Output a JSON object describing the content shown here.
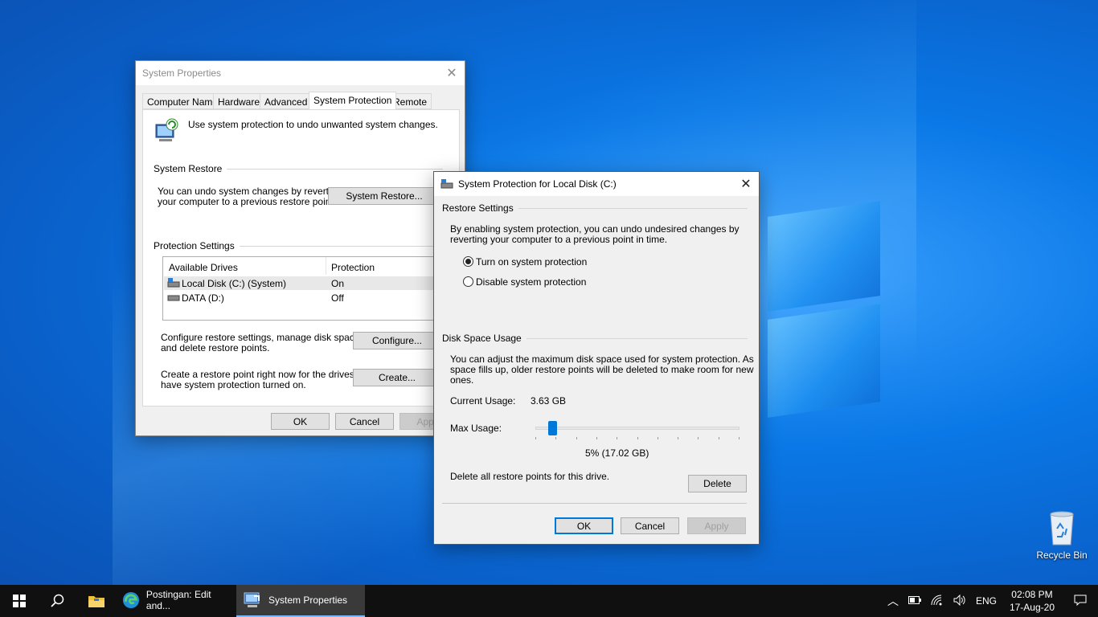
{
  "colors": {
    "accent": "#0078d7",
    "desktop": "#0a78e6",
    "taskbar": "#101010"
  },
  "desktop": {
    "recycle_bin_label": "Recycle Bin"
  },
  "system_properties": {
    "title": "System Properties",
    "tabs": [
      "Computer Name",
      "Hardware",
      "Advanced",
      "System Protection",
      "Remote"
    ],
    "active_tab": "System Protection",
    "intro_text": "Use system protection to undo unwanted system changes.",
    "system_restore_group": "System Restore",
    "system_restore_desc_1": "You can undo system changes by reverting",
    "system_restore_desc_2": "your computer to a previous restore point.",
    "system_restore_button": "System Restore...",
    "protection_group": "Protection Settings",
    "drives_columns": [
      "Available Drives",
      "Protection"
    ],
    "drives": [
      {
        "name": "Local Disk (C:) (System)",
        "protection": "On",
        "icon": "system-drive-icon"
      },
      {
        "name": "DATA (D:)",
        "protection": "Off",
        "icon": "drive-icon"
      }
    ],
    "configure_desc_1": "Configure restore settings, manage disk space,",
    "configure_desc_2": "and delete restore points.",
    "configure_button": "Configure...",
    "create_desc_1": "Create a restore point right now for the drives that",
    "create_desc_2": "have system protection turned on.",
    "create_button": "Create...",
    "ok": "OK",
    "cancel": "Cancel",
    "apply": "Apply"
  },
  "protection_dialog": {
    "title": "System Protection for Local Disk (C:)",
    "restore_group": "Restore Settings",
    "restore_desc_1": "By enabling system protection, you can undo undesired changes by",
    "restore_desc_2": "reverting your computer to a previous point in time.",
    "radio_on": "Turn on system protection",
    "radio_off": "Disable system protection",
    "selected": "on",
    "disk_group": "Disk Space Usage",
    "disk_desc_1": "You can adjust the maximum disk space used for system protection. As",
    "disk_desc_2": "space fills up, older restore points will be deleted to make room for new",
    "disk_desc_3": "ones.",
    "current_usage_label": "Current Usage:",
    "current_usage_value": "3.63 GB",
    "max_usage_label": "Max Usage:",
    "max_usage_percent": 5,
    "max_usage_text": "5% (17.02 GB)",
    "delete_desc": "Delete all restore points for this drive.",
    "delete_button": "Delete",
    "ok": "OK",
    "cancel": "Cancel",
    "apply": "Apply"
  },
  "taskbar": {
    "apps": [
      {
        "label": "Postingan: Edit and...",
        "icon": "edge-icon",
        "active": false
      },
      {
        "label": "System Properties",
        "icon": "system-properties-icon",
        "active": true
      }
    ],
    "language": "ENG",
    "time": "02:08 PM",
    "date": "17-Aug-20"
  }
}
